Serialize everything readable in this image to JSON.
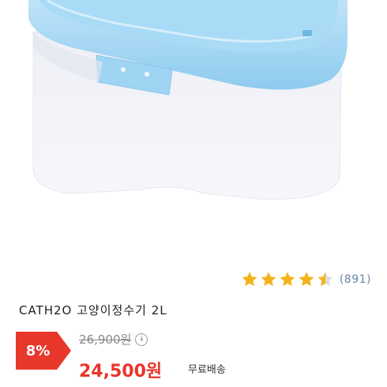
{
  "product": {
    "image_alt": "blue pet water fountain",
    "title": "CATH2O 고양이정수기 2L",
    "rating": 4.5,
    "rating_max": 5,
    "review_count": "(891)",
    "discount": "8%",
    "original_price": "26,900원",
    "price": "24,500원",
    "shipping": "무료배송"
  },
  "colors": {
    "star_filled": "#f5b21a",
    "star_empty": "#dcdcdc",
    "discount_bg": "#e8372b",
    "price": "#e8372b",
    "lid": "#9fd2f2"
  }
}
